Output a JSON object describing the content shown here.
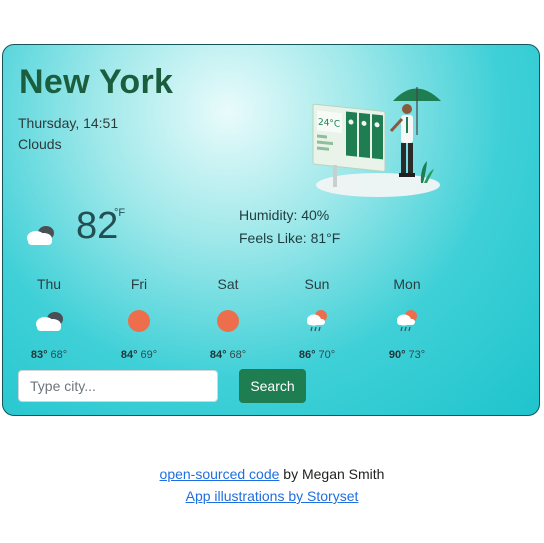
{
  "weather": {
    "city": "New York",
    "datetime": "Thursday, 14:51",
    "condition": "Clouds",
    "current_icon": "cloudy-icon",
    "temperature": "82",
    "unit": "°F",
    "humidity": "Humidity: 40%",
    "feels_like": "Feels Like: 81°F"
  },
  "forecast": [
    {
      "day": "Thu",
      "icon": "cloudy-icon",
      "high": "83°",
      "low": "68°"
    },
    {
      "day": "Fri",
      "icon": "sun-icon",
      "high": "84°",
      "low": "69°"
    },
    {
      "day": "Sat",
      "icon": "sun-icon",
      "high": "84°",
      "low": "68°"
    },
    {
      "day": "Sun",
      "icon": "sun-rain-icon",
      "high": "86°",
      "low": "70°"
    },
    {
      "day": "Mon",
      "icon": "sun-rain-icon",
      "high": "90°",
      "low": "73°"
    }
  ],
  "search": {
    "placeholder": "Type city...",
    "button_label": "Search"
  },
  "footer": {
    "source_link": "open-sourced code",
    "author_text": "by Megan Smith",
    "illustrations_link": "App illustrations by Storyset"
  },
  "colors": {
    "accent": "#1f7d52",
    "city_title": "#1b5e3e",
    "card_gradient_center": "#e9fbfb",
    "card_gradient_edge": "#1fc4cd",
    "link": "#1f6fe0",
    "sun": "#ec6e4c"
  }
}
